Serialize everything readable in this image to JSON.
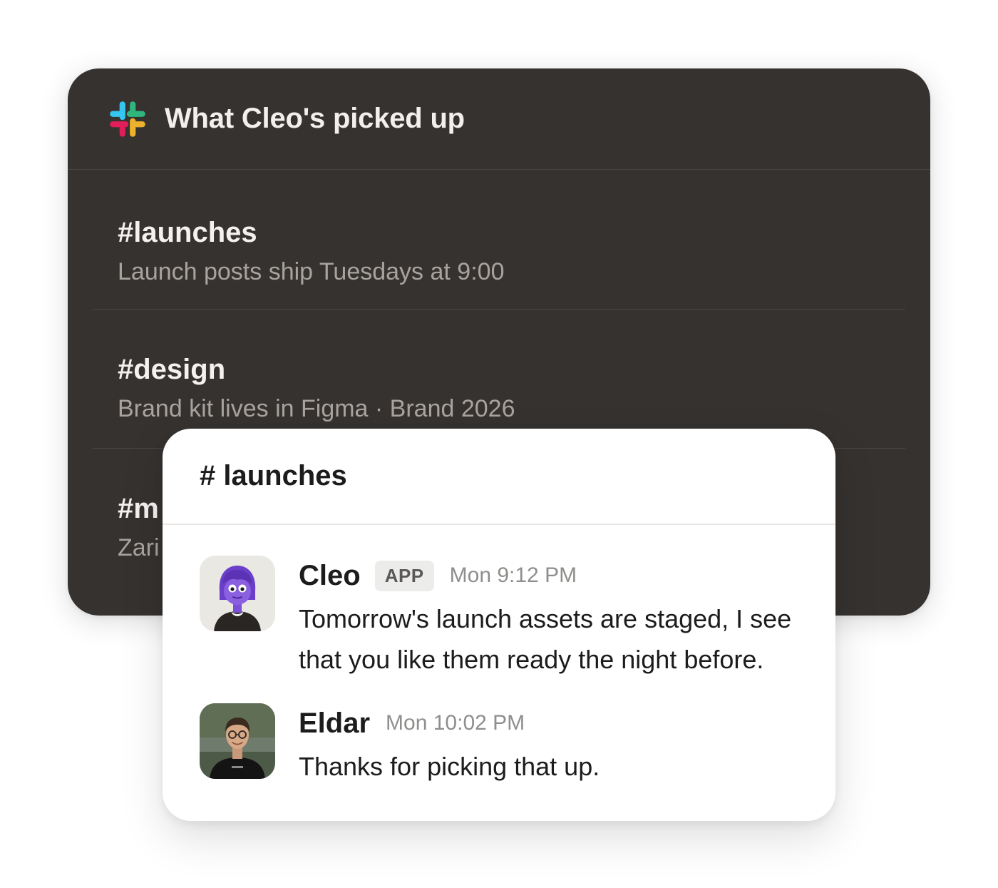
{
  "colors": {
    "dark_card_bg": "#353230",
    "white_card_bg": "#ffffff",
    "slack_blue": "#36C5F0",
    "slack_green": "#2EB67D",
    "slack_yellow": "#ECB22E",
    "slack_red": "#E01E5A",
    "app_badge_bg": "#ececea",
    "cleo_purple": "#7b4fd6"
  },
  "summary_card": {
    "logo_icon": "slack-logo-icon",
    "title": "What Cleo's picked up",
    "items": [
      {
        "channel": "#launches",
        "note": "Launch posts ship Tuesdays at 9:00"
      },
      {
        "channel": "#design",
        "note": "Brand kit lives in Figma · Brand 2026"
      },
      {
        "channel": "#m",
        "note": "Zari"
      }
    ]
  },
  "channel_card": {
    "title": "# launches",
    "messages": [
      {
        "author": "Cleo",
        "badge": "APP",
        "time": "Mon 9:12 PM",
        "avatar": "cleo-avatar",
        "text": "Tomorrow's launch assets are staged, I see that you like them ready the night before."
      },
      {
        "author": "Eldar",
        "time": "Mon 10:02 PM",
        "avatar": "eldar-avatar",
        "text": "Thanks for picking that up."
      }
    ]
  }
}
